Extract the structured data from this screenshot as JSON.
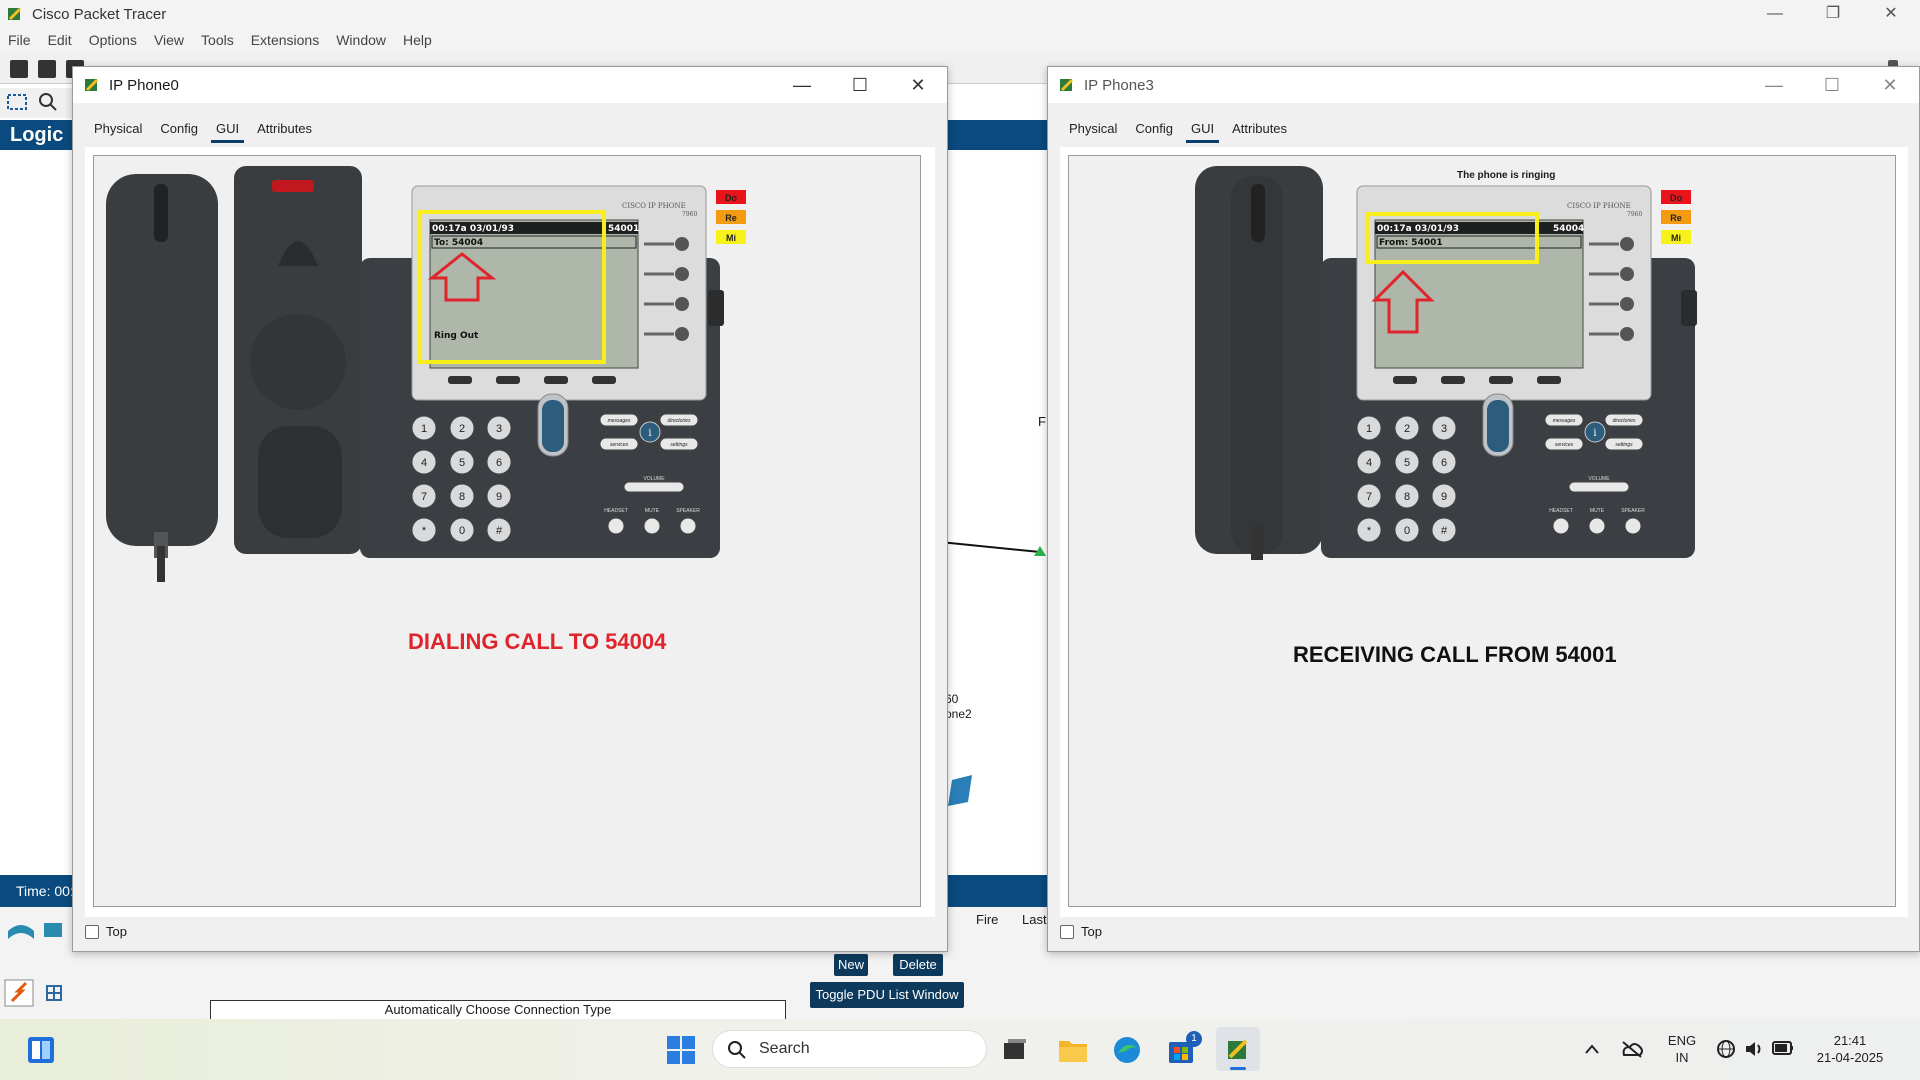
{
  "app": {
    "title": "Cisco Packet Tracer",
    "menu": [
      "File",
      "Edit",
      "Options",
      "View",
      "Tools",
      "Extensions",
      "Window",
      "Help"
    ],
    "logical_tab": "Logic",
    "time_label": "Time: 00:",
    "device_label_1": "60",
    "device_label_2": "one2",
    "link_label": "F",
    "fire_label": "Fire",
    "last_label": "Last",
    "new_button": "New",
    "delete_button": "Delete",
    "toggle_pdu_button": "Toggle PDU List Window",
    "connection_type": "Automatically Choose Connection Type"
  },
  "dialog_left": {
    "title": "IP Phone0",
    "tabs": [
      "Physical",
      "Config",
      "GUI",
      "Attributes"
    ],
    "active_tab": "GUI",
    "top_checkbox_label": "Top",
    "phone": {
      "brand": "CISCO IP PHONE",
      "model": "7960",
      "screen_header": "00:17a 03/01/93",
      "line_number": "54001",
      "line2": "To: 54004",
      "status": "Ring Out",
      "side_buttons": [
        "Do",
        "Re",
        "Mi"
      ],
      "keypad": [
        "1",
        "2",
        "3",
        "4",
        "5",
        "6",
        "7",
        "8",
        "9",
        "*",
        "0",
        "#"
      ],
      "soft_labels": [
        "messages",
        "directories",
        "services",
        "settings"
      ],
      "volume_label": "VOLUME",
      "func_labels": [
        "HEADSET",
        "MUTE",
        "SPEAKER"
      ]
    },
    "caption": "DIALING CALL TO 54004",
    "caption_color": "#e0242b"
  },
  "dialog_right": {
    "title": "IP Phone3",
    "tabs": [
      "Physical",
      "Config",
      "GUI",
      "Attributes"
    ],
    "active_tab": "GUI",
    "top_checkbox_label": "Top",
    "ringing_text": "The phone is ringing",
    "phone": {
      "brand": "CISCO IP PHONE",
      "model": "7960",
      "screen_header": "00:17a 03/01/93",
      "line_number": "54004",
      "line2": "From: 54001",
      "side_buttons": [
        "Do",
        "Re",
        "Mi"
      ],
      "keypad": [
        "1",
        "2",
        "3",
        "4",
        "5",
        "6",
        "7",
        "8",
        "9",
        "*",
        "0",
        "#"
      ],
      "soft_labels": [
        "messages",
        "directories",
        "services",
        "settings"
      ],
      "volume_label": "VOLUME",
      "func_labels": [
        "HEADSET",
        "MUTE",
        "SPEAKER"
      ]
    },
    "caption": "RECEIVING CALL FROM 54001",
    "caption_color": "#111111"
  },
  "taskbar": {
    "search_placeholder": "Search",
    "lang_top": "ENG",
    "lang_bottom": "IN",
    "time": "21:41",
    "date": "21-04-2025",
    "notification_count": "1"
  }
}
